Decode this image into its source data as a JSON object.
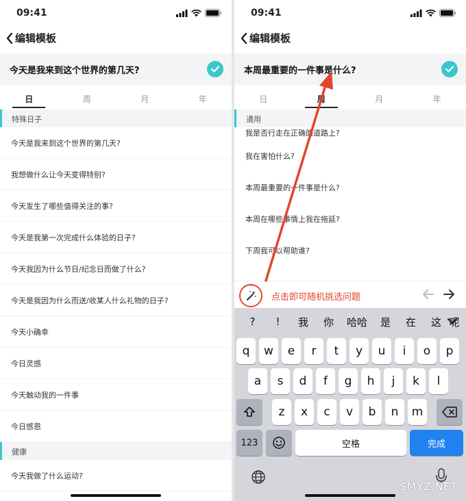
{
  "status": {
    "time": "09:41"
  },
  "left": {
    "back_label": "编辑模板",
    "question": "今天是我来到这个世界的第几天?",
    "tabs": [
      "日",
      "周",
      "月",
      "年"
    ],
    "active_tab": 0,
    "sections": [
      {
        "title": "特殊日子",
        "items": [
          "今天是我来到这个世界的第几天?",
          "我想做什么让今天变得特别?",
          "今天发生了哪些值得关注的事?",
          "今天是我第一次完成什么体验的日子?",
          "今天我因为什么节日/纪念日而做了什么?",
          "今天是我因为什么而送/收某人什么礼物的日子?",
          "今天小确幸",
          "今日灵感",
          "今天触动我的一件事",
          "今日感恩"
        ]
      },
      {
        "title": "健康",
        "items": [
          "今天我做了什么运动?"
        ]
      }
    ]
  },
  "right": {
    "back_label": "编辑模板",
    "question": "本周最重要的一件事是什么?",
    "tabs": [
      "日",
      "周",
      "月",
      "年"
    ],
    "active_tab": 1,
    "section_title": "通用",
    "items": [
      "我是否行走在正确的道路上?",
      "我在害怕什么?",
      "本周最重要的一件事是什么?",
      "本周在哪些事情上我在拖延?",
      "下周我可以帮助谁?"
    ],
    "random_hint": "点击即可随机挑选问题",
    "keyboard": {
      "candidates": [
        "?",
        "!",
        "我",
        "你",
        "哈哈",
        "是",
        "在",
        "这",
        "呢"
      ],
      "row1": [
        "q",
        "w",
        "e",
        "r",
        "t",
        "y",
        "u",
        "i",
        "o",
        "p"
      ],
      "row2": [
        "a",
        "s",
        "d",
        "f",
        "g",
        "h",
        "j",
        "k",
        "l"
      ],
      "row3": [
        "z",
        "x",
        "c",
        "v",
        "b",
        "n",
        "m"
      ],
      "numbers_label": "123",
      "space_label": "空格",
      "done_label": "完成"
    }
  },
  "watermark": "SMYZ.NET",
  "colors": {
    "accent": "#3bc6cc",
    "annotation": "#e2452b",
    "done_key": "#1f82f0"
  },
  "icons": [
    "signal-icon",
    "wifi-icon",
    "battery-icon",
    "chevron-left-icon",
    "check-icon",
    "magic-wand-icon",
    "arrow-left-icon",
    "arrow-right-icon",
    "shift-icon",
    "backspace-icon",
    "emoji-icon",
    "globe-icon",
    "microphone-icon",
    "chevron-down-icon"
  ]
}
